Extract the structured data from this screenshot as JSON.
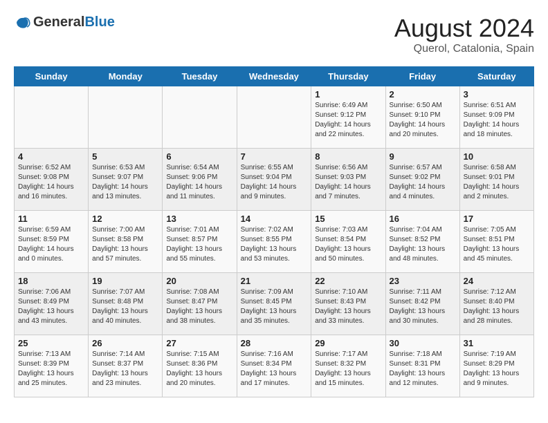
{
  "header": {
    "logo_general": "General",
    "logo_blue": "Blue",
    "title": "August 2024",
    "subtitle": "Querol, Catalonia, Spain"
  },
  "days_of_week": [
    "Sunday",
    "Monday",
    "Tuesday",
    "Wednesday",
    "Thursday",
    "Friday",
    "Saturday"
  ],
  "weeks": [
    [
      {
        "day": "",
        "info": ""
      },
      {
        "day": "",
        "info": ""
      },
      {
        "day": "",
        "info": ""
      },
      {
        "day": "",
        "info": ""
      },
      {
        "day": "1",
        "info": "Sunrise: 6:49 AM\nSunset: 9:12 PM\nDaylight: 14 hours\nand 22 minutes."
      },
      {
        "day": "2",
        "info": "Sunrise: 6:50 AM\nSunset: 9:10 PM\nDaylight: 14 hours\nand 20 minutes."
      },
      {
        "day": "3",
        "info": "Sunrise: 6:51 AM\nSunset: 9:09 PM\nDaylight: 14 hours\nand 18 minutes."
      }
    ],
    [
      {
        "day": "4",
        "info": "Sunrise: 6:52 AM\nSunset: 9:08 PM\nDaylight: 14 hours\nand 16 minutes."
      },
      {
        "day": "5",
        "info": "Sunrise: 6:53 AM\nSunset: 9:07 PM\nDaylight: 14 hours\nand 13 minutes."
      },
      {
        "day": "6",
        "info": "Sunrise: 6:54 AM\nSunset: 9:06 PM\nDaylight: 14 hours\nand 11 minutes."
      },
      {
        "day": "7",
        "info": "Sunrise: 6:55 AM\nSunset: 9:04 PM\nDaylight: 14 hours\nand 9 minutes."
      },
      {
        "day": "8",
        "info": "Sunrise: 6:56 AM\nSunset: 9:03 PM\nDaylight: 14 hours\nand 7 minutes."
      },
      {
        "day": "9",
        "info": "Sunrise: 6:57 AM\nSunset: 9:02 PM\nDaylight: 14 hours\nand 4 minutes."
      },
      {
        "day": "10",
        "info": "Sunrise: 6:58 AM\nSunset: 9:01 PM\nDaylight: 14 hours\nand 2 minutes."
      }
    ],
    [
      {
        "day": "11",
        "info": "Sunrise: 6:59 AM\nSunset: 8:59 PM\nDaylight: 14 hours\nand 0 minutes."
      },
      {
        "day": "12",
        "info": "Sunrise: 7:00 AM\nSunset: 8:58 PM\nDaylight: 13 hours\nand 57 minutes."
      },
      {
        "day": "13",
        "info": "Sunrise: 7:01 AM\nSunset: 8:57 PM\nDaylight: 13 hours\nand 55 minutes."
      },
      {
        "day": "14",
        "info": "Sunrise: 7:02 AM\nSunset: 8:55 PM\nDaylight: 13 hours\nand 53 minutes."
      },
      {
        "day": "15",
        "info": "Sunrise: 7:03 AM\nSunset: 8:54 PM\nDaylight: 13 hours\nand 50 minutes."
      },
      {
        "day": "16",
        "info": "Sunrise: 7:04 AM\nSunset: 8:52 PM\nDaylight: 13 hours\nand 48 minutes."
      },
      {
        "day": "17",
        "info": "Sunrise: 7:05 AM\nSunset: 8:51 PM\nDaylight: 13 hours\nand 45 minutes."
      }
    ],
    [
      {
        "day": "18",
        "info": "Sunrise: 7:06 AM\nSunset: 8:49 PM\nDaylight: 13 hours\nand 43 minutes."
      },
      {
        "day": "19",
        "info": "Sunrise: 7:07 AM\nSunset: 8:48 PM\nDaylight: 13 hours\nand 40 minutes."
      },
      {
        "day": "20",
        "info": "Sunrise: 7:08 AM\nSunset: 8:47 PM\nDaylight: 13 hours\nand 38 minutes."
      },
      {
        "day": "21",
        "info": "Sunrise: 7:09 AM\nSunset: 8:45 PM\nDaylight: 13 hours\nand 35 minutes."
      },
      {
        "day": "22",
        "info": "Sunrise: 7:10 AM\nSunset: 8:43 PM\nDaylight: 13 hours\nand 33 minutes."
      },
      {
        "day": "23",
        "info": "Sunrise: 7:11 AM\nSunset: 8:42 PM\nDaylight: 13 hours\nand 30 minutes."
      },
      {
        "day": "24",
        "info": "Sunrise: 7:12 AM\nSunset: 8:40 PM\nDaylight: 13 hours\nand 28 minutes."
      }
    ],
    [
      {
        "day": "25",
        "info": "Sunrise: 7:13 AM\nSunset: 8:39 PM\nDaylight: 13 hours\nand 25 minutes."
      },
      {
        "day": "26",
        "info": "Sunrise: 7:14 AM\nSunset: 8:37 PM\nDaylight: 13 hours\nand 23 minutes."
      },
      {
        "day": "27",
        "info": "Sunrise: 7:15 AM\nSunset: 8:36 PM\nDaylight: 13 hours\nand 20 minutes."
      },
      {
        "day": "28",
        "info": "Sunrise: 7:16 AM\nSunset: 8:34 PM\nDaylight: 13 hours\nand 17 minutes."
      },
      {
        "day": "29",
        "info": "Sunrise: 7:17 AM\nSunset: 8:32 PM\nDaylight: 13 hours\nand 15 minutes."
      },
      {
        "day": "30",
        "info": "Sunrise: 7:18 AM\nSunset: 8:31 PM\nDaylight: 13 hours\nand 12 minutes."
      },
      {
        "day": "31",
        "info": "Sunrise: 7:19 AM\nSunset: 8:29 PM\nDaylight: 13 hours\nand 9 minutes."
      }
    ]
  ]
}
